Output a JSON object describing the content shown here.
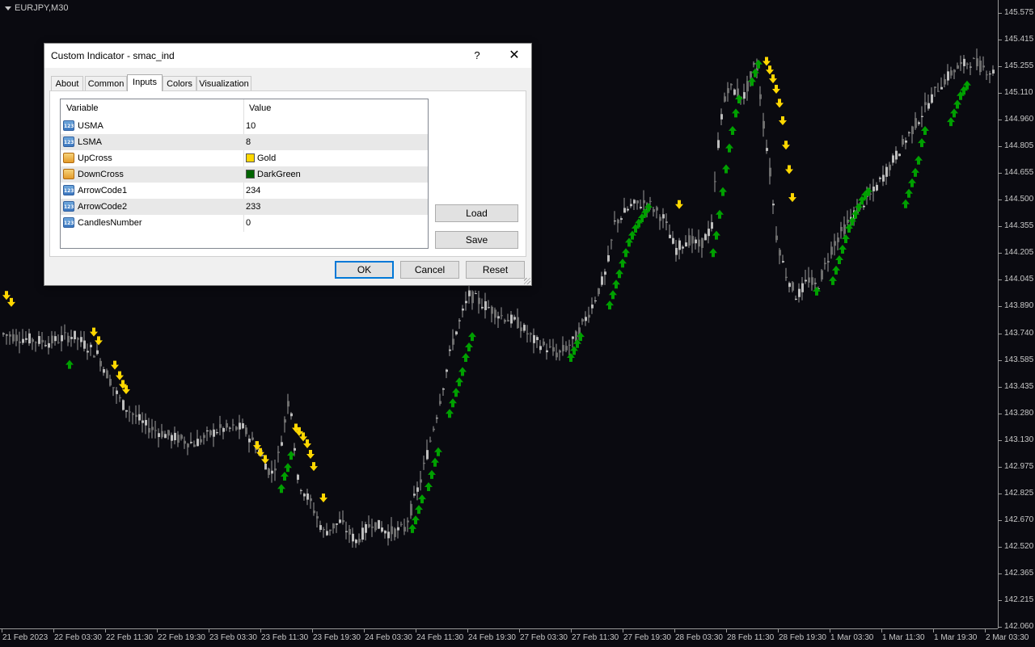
{
  "chart": {
    "symbol": "EURJPY,M30",
    "colors": {
      "background": "#0a0a10",
      "up_arrow": "#00a000",
      "down_arrow": "#ffd700",
      "candle": "#bdbdbd"
    },
    "price_labels": [
      "145.575",
      "145.415",
      "145.255",
      "145.110",
      "144.960",
      "144.805",
      "144.655",
      "144.500",
      "144.355",
      "144.205",
      "144.045",
      "143.890",
      "143.740",
      "143.585",
      "143.435",
      "143.280",
      "143.130",
      "142.975",
      "142.825",
      "142.670",
      "142.520",
      "142.365",
      "142.215",
      "142.060"
    ],
    "time_labels": [
      "21 Feb 2023",
      "22 Feb 03:30",
      "22 Feb 11:30",
      "22 Feb 19:30",
      "23 Feb 03:30",
      "23 Feb 11:30",
      "23 Feb 19:30",
      "24 Feb 03:30",
      "24 Feb 11:30",
      "24 Feb 19:30",
      "27 Feb 03:30",
      "27 Feb 11:30",
      "27 Feb 19:30",
      "28 Feb 03:30",
      "28 Feb 11:30",
      "28 Feb 19:30",
      "1 Mar 03:30",
      "1 Mar 11:30",
      "1 Mar 19:30",
      "2 Mar 03:30"
    ],
    "close_path": [
      [
        0,
        143.74
      ],
      [
        30,
        143.71
      ],
      [
        60,
        143.69
      ],
      [
        90,
        143.73
      ],
      [
        120,
        143.62
      ],
      [
        150,
        143.34
      ],
      [
        180,
        143.21
      ],
      [
        210,
        143.15
      ],
      [
        240,
        143.11
      ],
      [
        270,
        143.19
      ],
      [
        300,
        143.2
      ],
      [
        320,
        143.07
      ],
      [
        335,
        142.93
      ],
      [
        345,
        143.05
      ],
      [
        358,
        143.4
      ],
      [
        368,
        142.9
      ],
      [
        385,
        142.76
      ],
      [
        400,
        142.6
      ],
      [
        420,
        142.66
      ],
      [
        440,
        142.55
      ],
      [
        460,
        142.66
      ],
      [
        480,
        142.6
      ],
      [
        500,
        142.62
      ],
      [
        520,
        142.9
      ],
      [
        540,
        143.28
      ],
      [
        560,
        143.7
      ],
      [
        580,
        143.96
      ],
      [
        600,
        143.9
      ],
      [
        620,
        143.84
      ],
      [
        640,
        143.8
      ],
      [
        660,
        143.7
      ],
      [
        690,
        143.62
      ],
      [
        710,
        143.7
      ],
      [
        730,
        143.88
      ],
      [
        750,
        144.1
      ],
      [
        760,
        144.37
      ],
      [
        780,
        144.47
      ],
      [
        800,
        144.49
      ],
      [
        820,
        144.4
      ],
      [
        835,
        144.22
      ],
      [
        850,
        144.28
      ],
      [
        865,
        144.24
      ],
      [
        880,
        144.35
      ],
      [
        890,
        144.95
      ],
      [
        900,
        145.15
      ],
      [
        920,
        145.1
      ],
      [
        935,
        145.3
      ],
      [
        945,
        144.9
      ],
      [
        950,
        144.75
      ],
      [
        960,
        144.3
      ],
      [
        970,
        144.1
      ],
      [
        985,
        143.95
      ],
      [
        1000,
        144.05
      ],
      [
        1010,
        144.0
      ],
      [
        1030,
        144.25
      ],
      [
        1060,
        144.45
      ],
      [
        1080,
        144.55
      ],
      [
        1100,
        144.7
      ],
      [
        1120,
        144.85
      ],
      [
        1140,
        145.0
      ],
      [
        1160,
        145.15
      ],
      [
        1180,
        145.25
      ],
      [
        1200,
        145.3
      ],
      [
        1234,
        145.22
      ]
    ],
    "down_arrows": [
      [
        8,
        143.96
      ],
      [
        14,
        143.92
      ],
      [
        116,
        143.75
      ],
      [
        122,
        143.7
      ],
      [
        142,
        143.56
      ],
      [
        148,
        143.5
      ],
      [
        152,
        143.45
      ],
      [
        156,
        143.42
      ],
      [
        318,
        143.1
      ],
      [
        322,
        143.06
      ],
      [
        328,
        143.02
      ],
      [
        366,
        143.2
      ],
      [
        370,
        143.18
      ],
      [
        375,
        143.15
      ],
      [
        380,
        143.11
      ],
      [
        384,
        143.05
      ],
      [
        388,
        142.98
      ],
      [
        400,
        142.8
      ],
      [
        840,
        144.48
      ],
      [
        948,
        145.3
      ],
      [
        952,
        145.25
      ],
      [
        956,
        145.2
      ],
      [
        960,
        145.14
      ],
      [
        964,
        145.06
      ],
      [
        968,
        144.96
      ],
      [
        972,
        144.82
      ],
      [
        976,
        144.68
      ],
      [
        980,
        144.52
      ]
    ],
    "up_arrows": [
      [
        86,
        143.56
      ],
      [
        348,
        142.85
      ],
      [
        352,
        142.92
      ],
      [
        356,
        142.97
      ],
      [
        360,
        143.04
      ],
      [
        510,
        142.62
      ],
      [
        514,
        142.67
      ],
      [
        518,
        142.73
      ],
      [
        522,
        142.79
      ],
      [
        530,
        142.86
      ],
      [
        534,
        142.93
      ],
      [
        538,
        143.0
      ],
      [
        542,
        143.06
      ],
      [
        556,
        143.28
      ],
      [
        560,
        143.34
      ],
      [
        564,
        143.4
      ],
      [
        568,
        143.46
      ],
      [
        572,
        143.52
      ],
      [
        576,
        143.6
      ],
      [
        580,
        143.66
      ],
      [
        584,
        143.72
      ],
      [
        706,
        143.6
      ],
      [
        710,
        143.64
      ],
      [
        714,
        143.68
      ],
      [
        718,
        143.72
      ],
      [
        754,
        143.9
      ],
      [
        758,
        143.96
      ],
      [
        762,
        144.02
      ],
      [
        766,
        144.08
      ],
      [
        770,
        144.14
      ],
      [
        774,
        144.2
      ],
      [
        778,
        144.26
      ],
      [
        782,
        144.3
      ],
      [
        786,
        144.34
      ],
      [
        790,
        144.37
      ],
      [
        794,
        144.4
      ],
      [
        798,
        144.43
      ],
      [
        802,
        144.46
      ],
      [
        882,
        144.2
      ],
      [
        886,
        144.3
      ],
      [
        890,
        144.42
      ],
      [
        894,
        144.55
      ],
      [
        898,
        144.68
      ],
      [
        902,
        144.8
      ],
      [
        906,
        144.9
      ],
      [
        910,
        145.0
      ],
      [
        914,
        145.08
      ],
      [
        930,
        145.18
      ],
      [
        934,
        145.23
      ],
      [
        938,
        145.28
      ],
      [
        1010,
        143.98
      ],
      [
        1030,
        144.04
      ],
      [
        1034,
        144.1
      ],
      [
        1038,
        144.16
      ],
      [
        1042,
        144.22
      ],
      [
        1046,
        144.28
      ],
      [
        1050,
        144.34
      ],
      [
        1054,
        144.38
      ],
      [
        1058,
        144.42
      ],
      [
        1062,
        144.46
      ],
      [
        1066,
        144.5
      ],
      [
        1070,
        144.53
      ],
      [
        1074,
        144.55
      ],
      [
        1120,
        144.48
      ],
      [
        1124,
        144.54
      ],
      [
        1128,
        144.6
      ],
      [
        1132,
        144.66
      ],
      [
        1136,
        144.73
      ],
      [
        1140,
        144.83
      ],
      [
        1144,
        144.9
      ],
      [
        1176,
        144.95
      ],
      [
        1180,
        145.0
      ],
      [
        1184,
        145.05
      ],
      [
        1188,
        145.1
      ],
      [
        1192,
        145.13
      ],
      [
        1196,
        145.16
      ]
    ]
  },
  "dialog": {
    "title": "Custom Indicator - smac_ind",
    "help": "?",
    "close": "✕",
    "tabs": [
      "About",
      "Common",
      "Inputs",
      "Colors",
      "Visualization"
    ],
    "active_tab": "Inputs",
    "grid": {
      "headers": [
        "Variable",
        "Value"
      ],
      "rows": [
        {
          "icon": "123",
          "type": "num",
          "name": "USMA",
          "value": "10"
        },
        {
          "icon": "123",
          "type": "num",
          "name": "LSMA",
          "value": "8"
        },
        {
          "icon": "",
          "type": "col",
          "name": "UpCross",
          "value": "Gold",
          "swatch": "#ffd700"
        },
        {
          "icon": "",
          "type": "col",
          "name": "DownCross",
          "value": "DarkGreen",
          "swatch": "#006400"
        },
        {
          "icon": "123",
          "type": "num",
          "name": "ArrowCode1",
          "value": "234"
        },
        {
          "icon": "123",
          "type": "num",
          "name": "ArrowCode2",
          "value": "233"
        },
        {
          "icon": "123",
          "type": "num",
          "name": "CandlesNumber",
          "value": "0"
        }
      ]
    },
    "buttons": {
      "load": "Load",
      "save": "Save",
      "ok": "OK",
      "cancel": "Cancel",
      "reset": "Reset"
    }
  }
}
